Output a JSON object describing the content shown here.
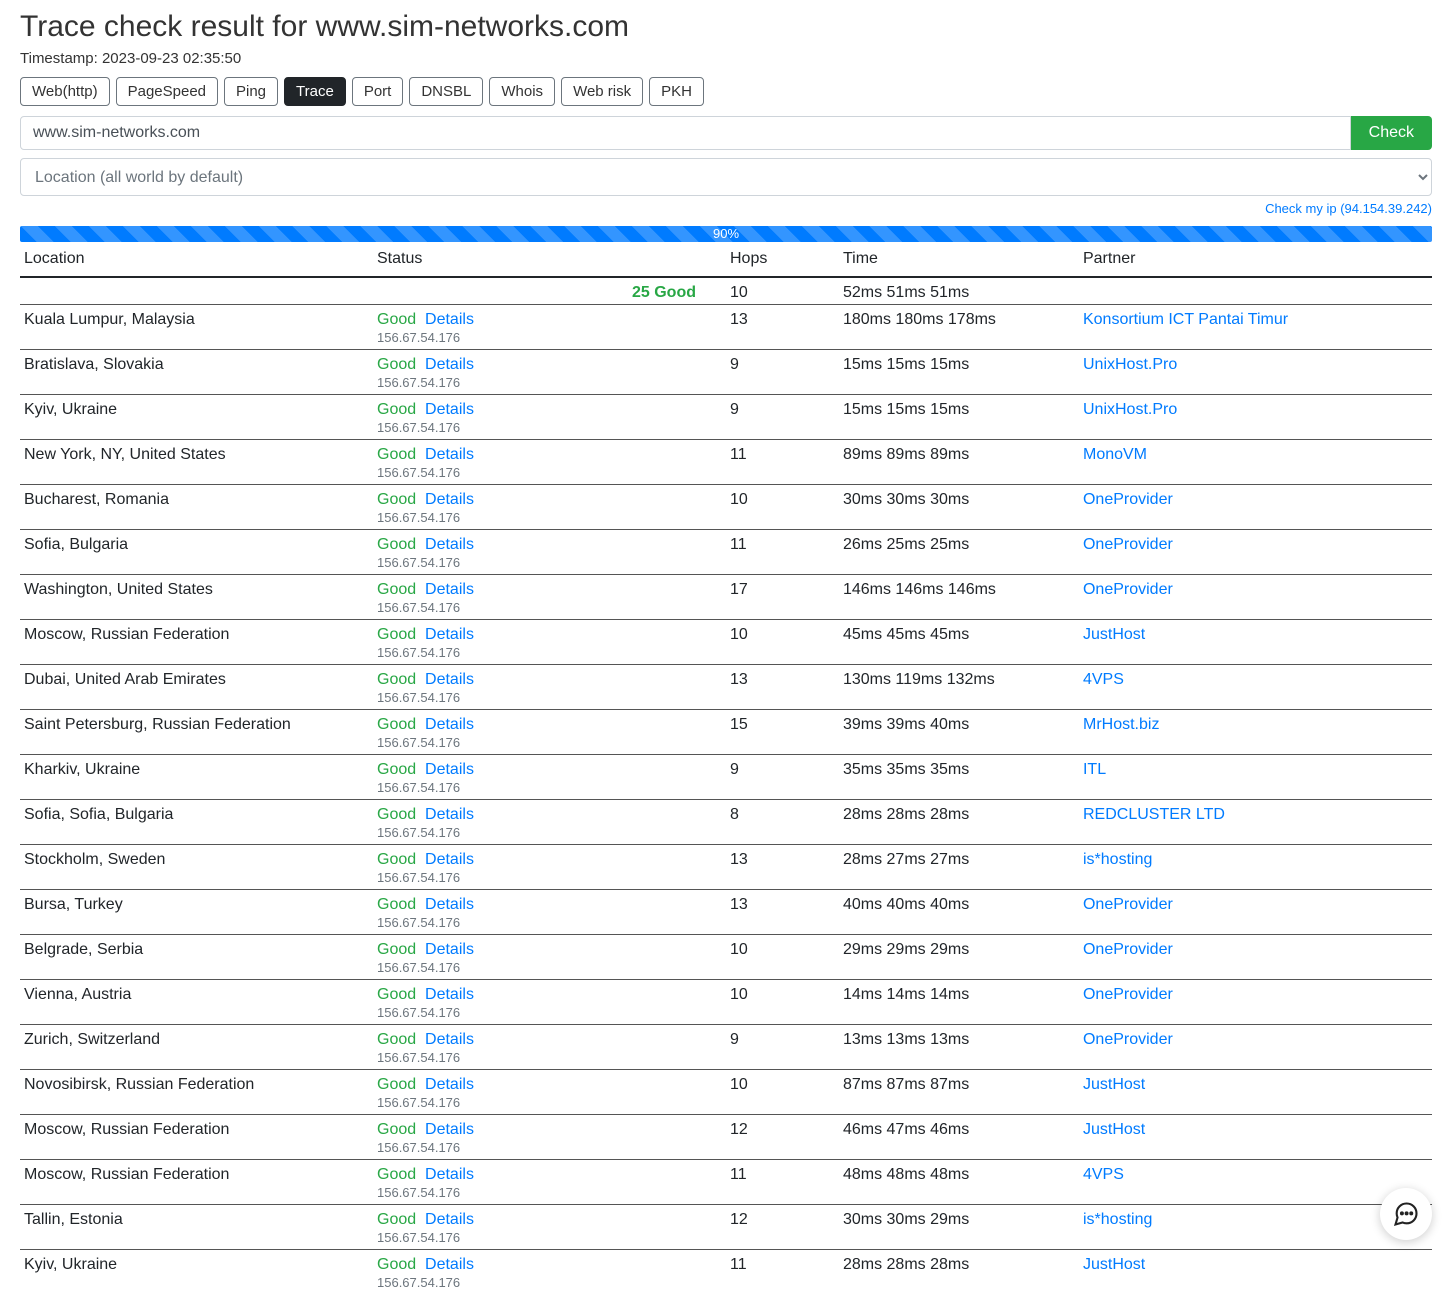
{
  "header": {
    "title": "Trace check result for www.sim-networks.com",
    "timestamp": "Timestamp: 2023-09-23 02:35:50"
  },
  "tabs": [
    "Web(http)",
    "PageSpeed",
    "Ping",
    "Trace",
    "Port",
    "DNSBL",
    "Whois",
    "Web risk",
    "PKH"
  ],
  "active_tab": "Trace",
  "form": {
    "input_value": "www.sim-networks.com",
    "check_button": "Check",
    "location_placeholder": "Location (all world by default)",
    "check_my_ip": "Check my ip (94.154.39.242)"
  },
  "progress": "90%",
  "table": {
    "headers": {
      "location": "Location",
      "status": "Status",
      "hops": "Hops",
      "time": "Time",
      "partner": "Partner"
    },
    "summary": {
      "status": "25 Good",
      "hops": "10",
      "time": "52ms  51ms  51ms"
    },
    "status_good": "Good",
    "details": "Details",
    "ip": "156.67.54.176",
    "rows": [
      {
        "loc": "Kuala Lumpur, Malaysia",
        "hops": "13",
        "time": "180ms  180ms  178ms",
        "partner": "Konsortium ICT Pantai Timur"
      },
      {
        "loc": "Bratislava, Slovakia",
        "hops": "9",
        "time": "15ms  15ms  15ms",
        "partner": "UnixHost.Pro"
      },
      {
        "loc": "Kyiv, Ukraine",
        "hops": "9",
        "time": "15ms  15ms  15ms",
        "partner": "UnixHost.Pro"
      },
      {
        "loc": "New York, NY, United States",
        "hops": "11",
        "time": "89ms  89ms  89ms",
        "partner": "MonoVM"
      },
      {
        "loc": "Bucharest, Romania",
        "hops": "10",
        "time": "30ms  30ms  30ms",
        "partner": "OneProvider"
      },
      {
        "loc": "Sofia, Bulgaria",
        "hops": "11",
        "time": "26ms  25ms  25ms",
        "partner": "OneProvider"
      },
      {
        "loc": "Washington, United States",
        "hops": "17",
        "time": "146ms  146ms  146ms",
        "partner": "OneProvider"
      },
      {
        "loc": "Moscow, Russian Federation",
        "hops": "10",
        "time": "45ms  45ms  45ms",
        "partner": "JustHost"
      },
      {
        "loc": "Dubai, United Arab Emirates",
        "hops": "13",
        "time": "130ms  119ms  132ms",
        "partner": "4VPS"
      },
      {
        "loc": "Saint Petersburg, Russian Federation",
        "hops": "15",
        "time": "39ms  39ms  40ms",
        "partner": "MrHost.biz"
      },
      {
        "loc": "Kharkiv, Ukraine",
        "hops": "9",
        "time": "35ms  35ms  35ms",
        "partner": "ITL"
      },
      {
        "loc": "Sofia, Sofia, Bulgaria",
        "hops": "8",
        "time": "28ms  28ms  28ms",
        "partner": "REDCLUSTER LTD"
      },
      {
        "loc": "Stockholm, Sweden",
        "hops": "13",
        "time": "28ms  27ms  27ms",
        "partner": "is*hosting"
      },
      {
        "loc": "Bursa, Turkey",
        "hops": "13",
        "time": "40ms  40ms  40ms",
        "partner": "OneProvider"
      },
      {
        "loc": "Belgrade, Serbia",
        "hops": "10",
        "time": "29ms  29ms  29ms",
        "partner": "OneProvider"
      },
      {
        "loc": "Vienna, Austria",
        "hops": "10",
        "time": "14ms  14ms  14ms",
        "partner": "OneProvider"
      },
      {
        "loc": "Zurich, Switzerland",
        "hops": "9",
        "time": "13ms  13ms  13ms",
        "partner": "OneProvider"
      },
      {
        "loc": "Novosibirsk, Russian Federation",
        "hops": "10",
        "time": "87ms  87ms  87ms",
        "partner": "JustHost"
      },
      {
        "loc": "Moscow, Russian Federation",
        "hops": "12",
        "time": "46ms  47ms  46ms",
        "partner": "JustHost"
      },
      {
        "loc": "Moscow, Russian Federation",
        "hops": "11",
        "time": "48ms  48ms  48ms",
        "partner": "4VPS"
      },
      {
        "loc": "Tallin, Estonia",
        "hops": "12",
        "time": "30ms  30ms  29ms",
        "partner": "is*hosting"
      },
      {
        "loc": "Kyiv, Ukraine",
        "hops": "11",
        "time": "28ms  28ms  28ms",
        "partner": "JustHost"
      }
    ]
  }
}
